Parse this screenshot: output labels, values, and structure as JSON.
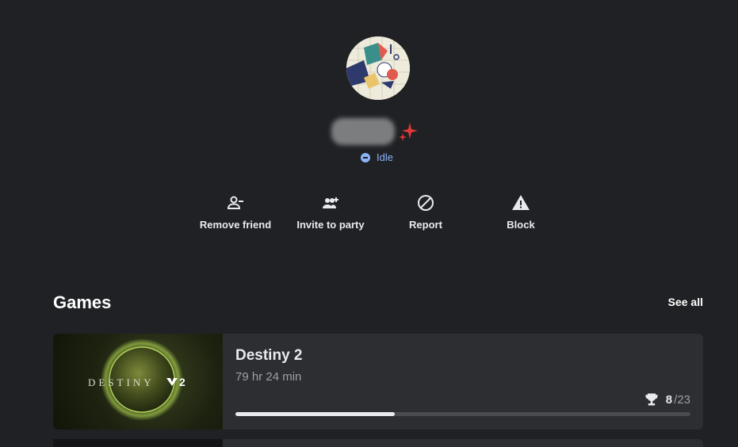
{
  "profile": {
    "status": "Idle",
    "colors": {
      "status": "#8ab4f8",
      "sparkle": "#e53935"
    }
  },
  "actions": [
    {
      "label": "Remove friend",
      "icon": "remove-person-icon"
    },
    {
      "label": "Invite to party",
      "icon": "group-add-icon"
    },
    {
      "label": "Report",
      "icon": "block-circle-icon"
    },
    {
      "label": "Block",
      "icon": "warning-icon"
    }
  ],
  "games": {
    "title": "Games",
    "see_all_label": "See all",
    "items": [
      {
        "title": "Destiny 2",
        "playtime": "79 hr 24 min",
        "art_text": "DESTINY",
        "art_suffix": "2",
        "achievements_earned": "8",
        "achievements_sep": "/",
        "achievements_total": "23",
        "progress": 0.35
      }
    ]
  }
}
